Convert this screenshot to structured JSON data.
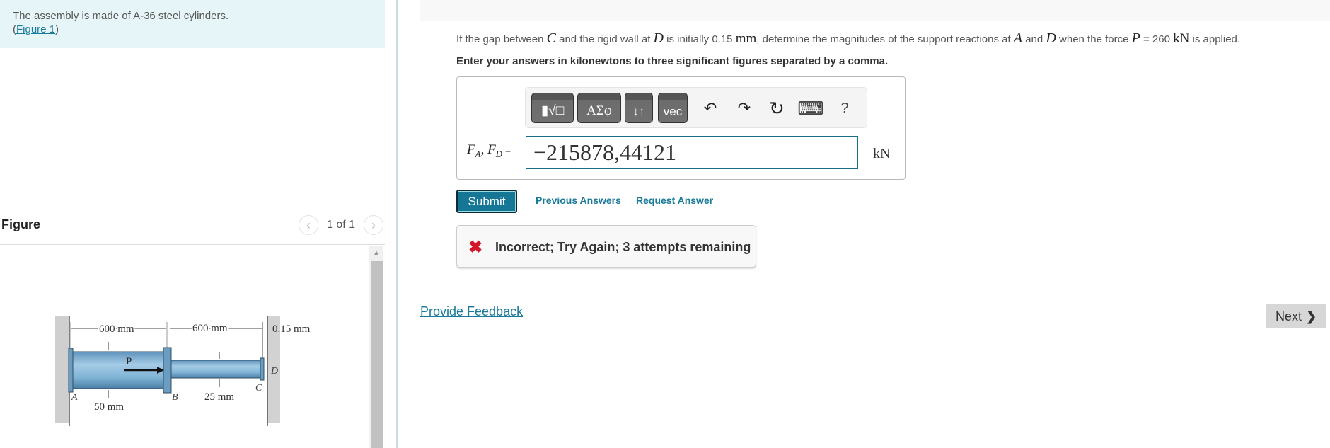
{
  "intro": {
    "text": "The assembly is made of A-36 steel cylinders.",
    "figure_link_prefix": "(",
    "figure_link": "Figure 1",
    "figure_link_suffix": ")"
  },
  "figure_panel": {
    "title": "Figure",
    "pager_text": "1 of 1",
    "prev_icon": "chevron-left-icon",
    "next_icon": "chevron-right-icon",
    "figure": {
      "dim_left_length": "600 mm",
      "dim_right_length": "600 mm",
      "dim_gap": "0.15 mm",
      "dim_left_diameter": "50 mm",
      "dim_right_diameter": "25 mm",
      "label_a": "A",
      "label_b": "B",
      "label_c": "C",
      "label_d": "D",
      "label_p": "P",
      "colors": {
        "cylinder": "#7fb3d5",
        "wall": "#c8c8c8"
      }
    }
  },
  "question": {
    "t1": "If the gap between ",
    "m_c": "C",
    "t2": " and the rigid wall at ",
    "m_d": "D",
    "t3": " is initially 0.15 ",
    "u_mm": "mm",
    "t4": ", determine the magnitudes of the support reactions at ",
    "m_a": "A",
    "t5": " and ",
    "m_d2": "D",
    "t6": " when the force ",
    "m_p": "P",
    "t7": " = 260 ",
    "u_kn": "kN",
    "t8": " is applied.",
    "instructions": "Enter your answers in kilonewtons to three significant figures separated by a comma."
  },
  "toolbar": {
    "templates_label": "▮√□",
    "greek_label": "ΑΣφ",
    "arrows_label": "↓↑",
    "vec_label": "vec",
    "undo_glyph": "↶",
    "redo_glyph": "↷",
    "reset_glyph": "↻",
    "keyboard_glyph": "⌨",
    "help_glyph": "?"
  },
  "answer": {
    "label_f": "F",
    "label_sub_a": "A",
    "label_sep": ", ",
    "label_f2": "F",
    "label_sub_d": "D",
    "label_eq": " =",
    "value": "−215878,44121",
    "unit": "kN"
  },
  "actions": {
    "submit": "Submit",
    "previous_answers": "Previous Answers",
    "request_answer": "Request Answer"
  },
  "feedback": {
    "icon": "✖",
    "text": "Incorrect; Try Again; 3 attempts remaining",
    "status_color": "#d2172a"
  },
  "footer": {
    "provide_feedback": "Provide Feedback",
    "next": "Next",
    "next_glyph": "❯"
  }
}
